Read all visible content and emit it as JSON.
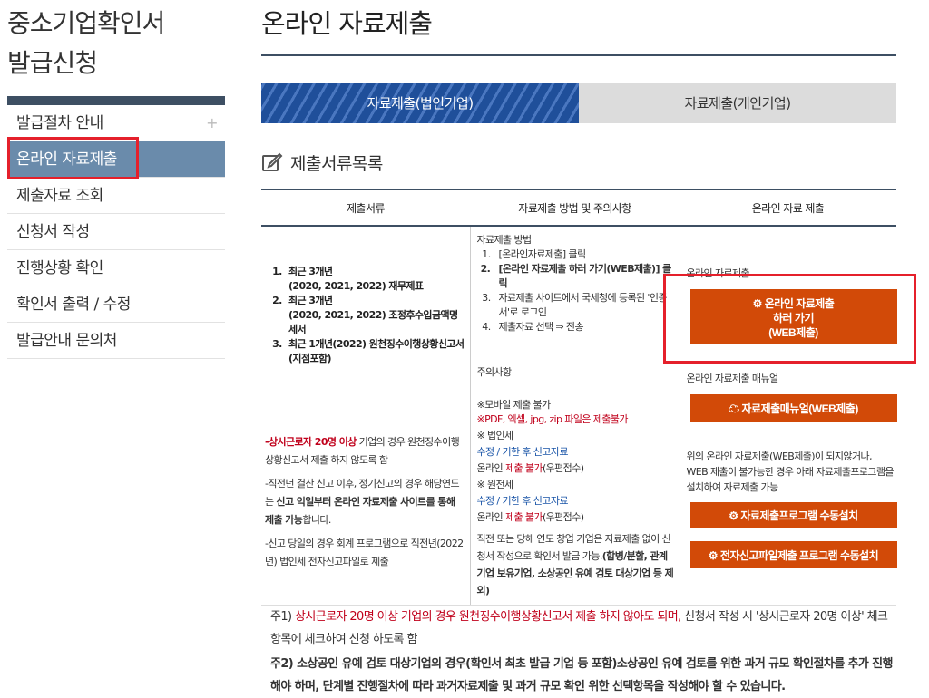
{
  "sidebar": {
    "title": "중소기업확인서\n발급신청",
    "items": [
      {
        "label": "발급절차 안내",
        "plus": "+"
      },
      {
        "label": "온라인 자료제출"
      },
      {
        "label": "제출자료 조회"
      },
      {
        "label": "신청서 작성"
      },
      {
        "label": "진행상황 확인"
      },
      {
        "label": "확인서 출력 / 수정"
      },
      {
        "label": "발급안내 문의처"
      }
    ]
  },
  "main": {
    "title": "온라인 자료제출",
    "tabs": [
      {
        "label": "자료제출(법인기업)"
      },
      {
        "label": "자료제출(개인기업)"
      }
    ],
    "section_title": "제출서류목록",
    "table": {
      "headers": [
        "제출서류",
        "자료제출 방법 및 주의사항",
        "온라인 자료 제출"
      ],
      "docs": [
        "최근 3개년\n(2020, 2021, 2022) 재무제표",
        "최근 3개년\n(2020, 2021, 2022) 조정후수입금액명세서",
        "최근 1개년(2022) 원천징수이행상황신고서\n(지점포함)"
      ],
      "note1_red": "-상시근로자 20명 이상",
      "note1_rest": " 기업의 경우 원천징수이행상황신고서 제출 하지 않도록 함",
      "note2_pre": "-직전년 결산 신고 이후, 정기신고의 경우 해당연도는 ",
      "note2_bold": "신고 익일부터 온라인 자료제출 사이트를 통해 제출 가능",
      "note2_post": "합니다.",
      "note3": "-신고 당일의 경우 회계 프로그램으로 직전년(2022년) 법인세 전자신고파일로 제출",
      "method_title": "자료제출 방법",
      "method_steps": [
        "[온라인자료제출] 클릭",
        "[온라인 자료제출 하러 가기(WEB제출)] 클릭",
        "자료제출 사이트에서 국세청에 등록된 '인증서'로 로그인",
        "제출자료 선택 ⇒ 전송"
      ],
      "caution_title": "주의사항",
      "mobile_na": "※모바일 제출 불가",
      "pdf_na": "※PDF, 엑셀, jpg, zip 파일은 제출불가",
      "corp_tax": "※ 법인세",
      "amend1": "수정 / 기한 후 신고자료",
      "online1_pre": "온라인 ",
      "online1_red": "제출 불가",
      "online1_post": "(우편접수)",
      "withholding": "※ 원천세",
      "amend2": "수정 / 기한 후 신고자료",
      "online2_pre": "온라인 ",
      "online2_red": "제출 불가",
      "online2_post": "(우편접수)",
      "startup_pre": "직전 또는 당해 연도 창업 기업은 자료제출 없이 신청서 작성으로 확인서 발급 가능.",
      "startup_bold": "(합병/분할, 관계기업 보유기업, 소상공인 유예 검토 대상기업 등 제외)",
      "online_label": "온라인 자료제출",
      "submit_btn": "온라인 자료제출\n하러 가기\n(WEB제출)",
      "manual_label": "온라인 자료제출 매뉴얼",
      "manual_btn": "자료제출매뉴얼(WEB제출)",
      "fallback_text": "위의 온라인 자료제출(WEB제출)이 되지않거나, WEB 제출이 불가능한 경우 아래 자료제출프로그램을 설치하여 자료제출 가능",
      "install_btn": "자료제출프로그램 수동설치",
      "efile_btn": "전자신고파일제출 프로그램 수동설치"
    },
    "footnotes": {
      "f1_prefix": "주1) ",
      "f1_red": "상시근로자 20명 이상 기업의 경우 원천징수이행상황신고서 제출 하지 않아도 되며,",
      "f1_rest": " 신청서 작성 시 '상시근로자 20명 이상' 체크항목에 체크하여 신청 하도록 함",
      "f2": "주2) 소상공인 유예 검토 대상기업의 경우(확인서 최초 발급 기업 등 포함)소상공인 유예 검토를 위한 과거 규모 확인절차를 추가 진행해야 하며, 단계별 진행절차에 따라 과거자료제출 및 과거 규모 확인 위한 선택항목을 작성해야 할 수 있습니다."
    }
  },
  "colors": {
    "accent": "#d24a08",
    "highlight": "#e5202b",
    "sidebar_active": "#6a8bab",
    "tab_active": "#1f4f9a"
  }
}
